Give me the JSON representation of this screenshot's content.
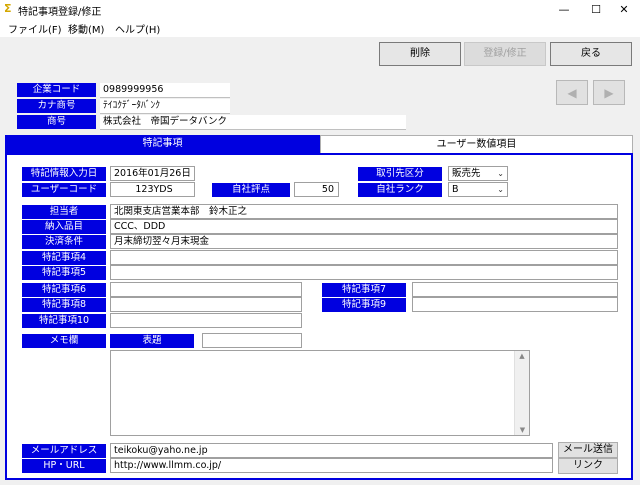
{
  "window": {
    "title": "特記事項登録/修正",
    "controls": [
      "—",
      "☐",
      "✕"
    ]
  },
  "menu": {
    "items": [
      "ファイル(F)",
      "移動(M)",
      "ヘルプ(H)"
    ]
  },
  "toolbar": {
    "delete_label": "削除",
    "register_label": "登録/修正",
    "back_label": "戻る",
    "prev_label": "◀",
    "next_label": "▶"
  },
  "header": {
    "company_code_label": "企業コード",
    "company_code": "0989999956",
    "kana_label": "カナ商号",
    "kana_name": "ﾃｲｺｸﾃﾞｰﾀﾊﾞﾝｸ",
    "name_label": "商号",
    "company_name": "株式会社　帝国データバンク"
  },
  "tabs": [
    {
      "label": "特記事項",
      "active": true
    },
    {
      "label": "ユーザー数値項目",
      "active": false
    }
  ],
  "form": {
    "entry_date_label": "特記情報入力日",
    "entry_date": "2016年01月26日",
    "user_code_label": "ユーザーコード",
    "user_code": "123YDS",
    "rating_label": "自社評点",
    "rating": "50",
    "partner_type_label": "取引先区分",
    "partner_type": "販売先",
    "rank_label": "自社ランク",
    "rank": "B",
    "person_label": "担当者",
    "person": "北関東支店営業本部　鈴木正之",
    "products_label": "納入品目",
    "products": "CCC、DDD",
    "payment_label": "決済条件",
    "payment": "月末締切翌々月末現金",
    "note4_label": "特記事項4",
    "note5_label": "特記事項5",
    "note6_label": "特記事項6",
    "note7_label": "特記事項7",
    "note8_label": "特記事項8",
    "note9_label": "特記事項9",
    "note10_label": "特記事項10",
    "memo_label": "メモ欄",
    "subject_label": "表題",
    "subject": "",
    "memo": "",
    "email_label": "メールアドレス",
    "email": "teikoku@yaho.ne.jp",
    "url_label": "HP・URL",
    "url": "http://www.llmm.co.jp/",
    "mail_button": "メール送信",
    "link_button": "リンク"
  }
}
